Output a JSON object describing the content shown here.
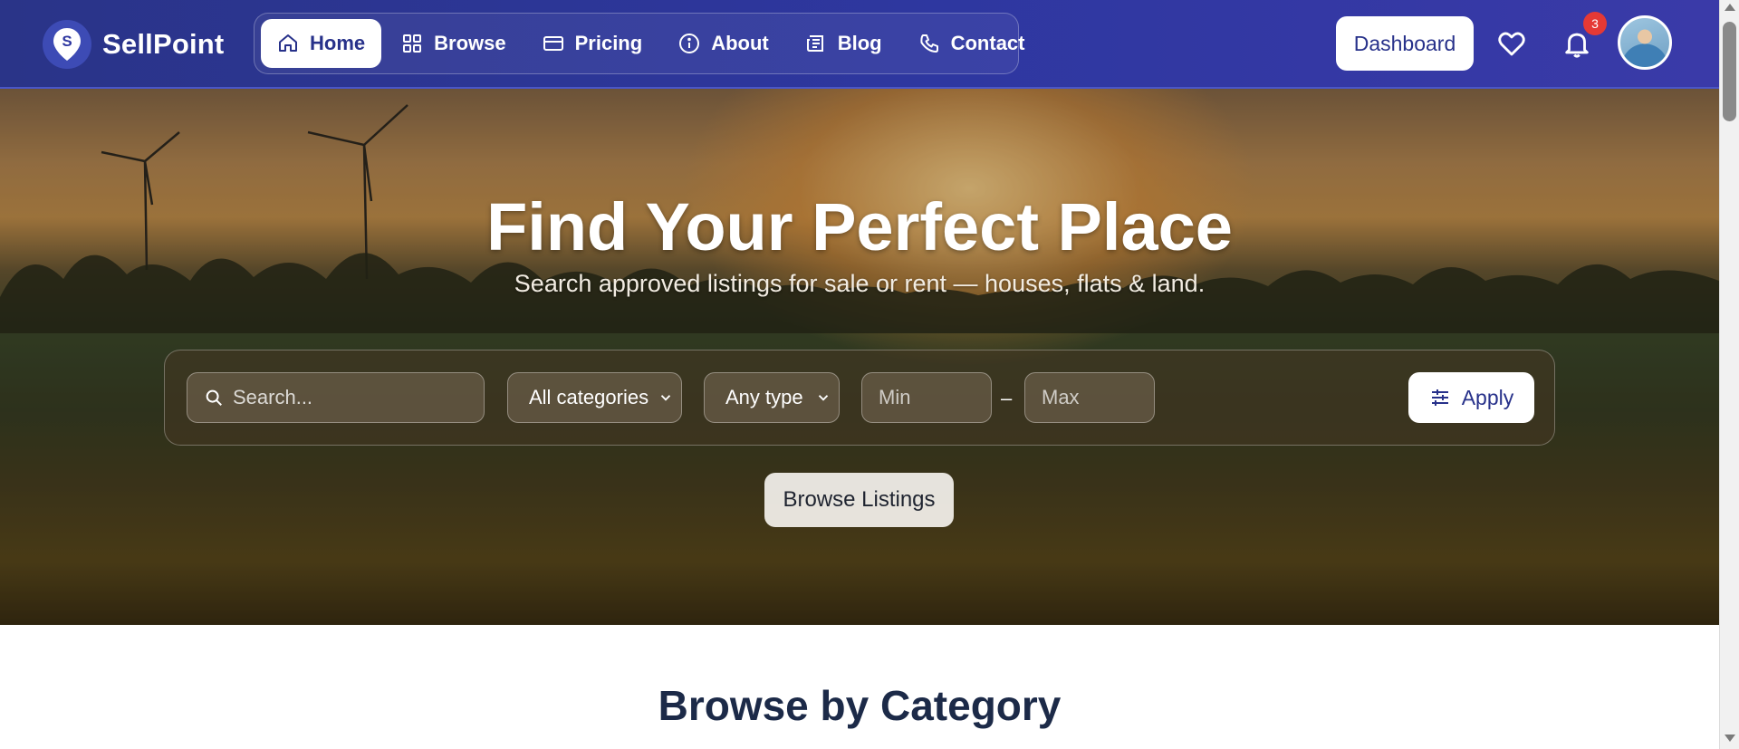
{
  "brand": {
    "name": "SellPoint",
    "logo_letter": "S"
  },
  "nav": {
    "items": [
      {
        "label": "Home",
        "icon": "home-icon",
        "active": true
      },
      {
        "label": "Browse",
        "icon": "grid-icon",
        "active": false
      },
      {
        "label": "Pricing",
        "icon": "card-icon",
        "active": false
      },
      {
        "label": "About",
        "icon": "info-icon",
        "active": false
      },
      {
        "label": "Blog",
        "icon": "newspaper-icon",
        "active": false
      },
      {
        "label": "Contact",
        "icon": "phone-icon",
        "active": false
      }
    ]
  },
  "header": {
    "dashboard_label": "Dashboard",
    "notification_count": "3"
  },
  "hero": {
    "title": "Find Your Perfect Place",
    "subtitle": "Search approved listings for sale or rent — houses, flats & land.",
    "search": {
      "placeholder": "Search...",
      "category_selected": "All categories",
      "type_selected": "Any type",
      "min_placeholder": "Min",
      "range_separator": "–",
      "max_placeholder": "Max",
      "apply_label": "Apply"
    },
    "browse_label": "Browse Listings"
  },
  "section": {
    "title": "Browse by Category"
  },
  "colors": {
    "brand": "#2e37a0",
    "accent_text": "#27318a",
    "badge": "#e53935",
    "heading": "#1c2a48"
  }
}
